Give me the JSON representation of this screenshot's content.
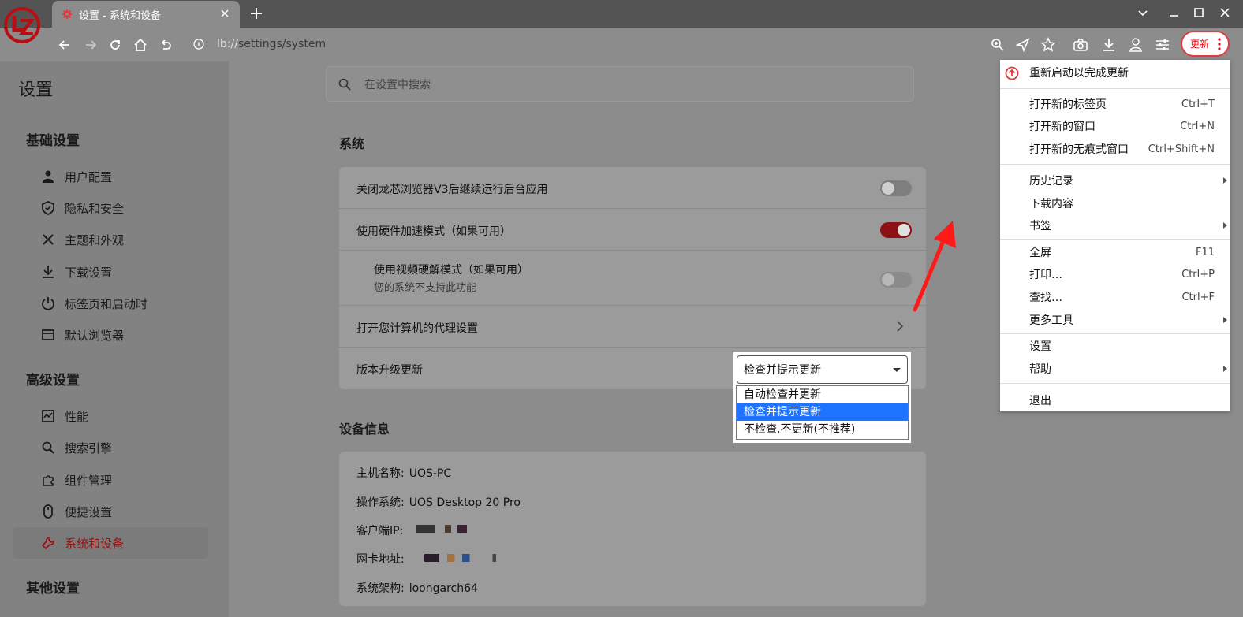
{
  "tab": {
    "title": "设置 - 系统和设备"
  },
  "address": {
    "host": "lb://",
    "path": "settings/system"
  },
  "toolbar": {
    "update_label": "更新"
  },
  "page_title": "设置",
  "search": {
    "placeholder": "在设置中搜索"
  },
  "sidebar": {
    "basic_head": "基础设置",
    "basic_items": [
      "用户配置",
      "隐私和安全",
      "主题和外观",
      "下载设置",
      "标签页和启动时",
      "默认浏览器"
    ],
    "advanced_head": "高级设置",
    "advanced_items": [
      "性能",
      "搜索引擎",
      "组件管理",
      "便捷设置",
      "系统和设备"
    ],
    "other_head": "其他设置"
  },
  "system": {
    "heading": "系统",
    "bg_apps": "关闭龙芯浏览器V3后继续运行后台应用",
    "hw_accel": "使用硬件加速模式（如果可用）",
    "video_decode": "使用视频硬解模式（如果可用）",
    "video_decode_sub": "您的系统不支持此功能",
    "proxy": "打开您计算机的代理设置",
    "upgrade": "版本升级更新"
  },
  "select": {
    "value": "检查并提示更新",
    "options": [
      "自动检查并更新",
      "检查并提示更新",
      "不检查,不更新(不推荐)"
    ]
  },
  "device": {
    "heading": "设备信息",
    "host_label": "主机名称:",
    "host_value": "UOS-PC",
    "os_label": "操作系统:",
    "os_value": "UOS Desktop 20 Pro",
    "ip_label": "客户端IP:",
    "mac_label": "网卡地址:",
    "arch_label": "系统架构:",
    "arch_value": "loongarch64"
  },
  "menu": {
    "restart": "重新启动以完成更新",
    "new_tab": "打开新的标签页",
    "new_tab_sc": "Ctrl+T",
    "new_window": "打开新的窗口",
    "new_window_sc": "Ctrl+N",
    "incognito": "打开新的无痕式窗口",
    "incognito_sc": "Ctrl+Shift+N",
    "history": "历史记录",
    "downloads": "下载内容",
    "bookmarks": "书签",
    "fullscreen": "全屏",
    "fullscreen_sc": "F11",
    "print": "打印…",
    "print_sc": "Ctrl+P",
    "find": "查找…",
    "find_sc": "Ctrl+F",
    "more_tools": "更多工具",
    "settings": "设置",
    "help": "帮助",
    "exit": "退出"
  },
  "colors": {
    "accent_red": "#d40b14",
    "select_blue": "#1e74ff"
  }
}
